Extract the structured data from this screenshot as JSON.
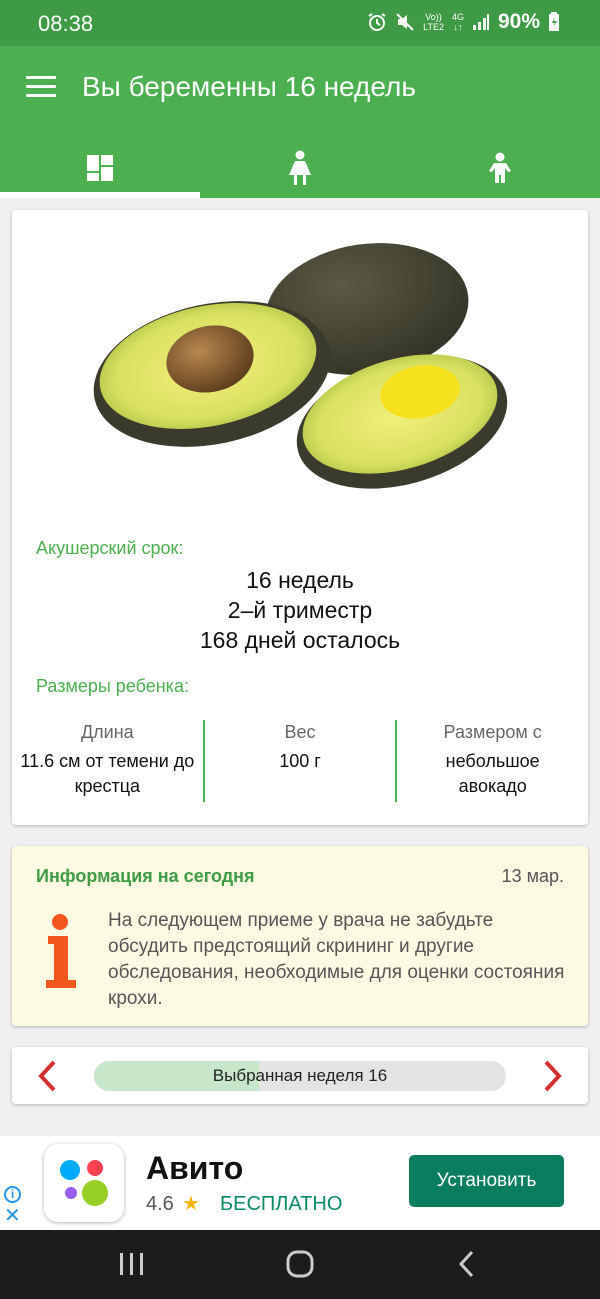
{
  "status_bar": {
    "time": "08:38",
    "volte_top": "Vo))",
    "volte_bottom": "LTE2",
    "network": "4G",
    "battery": "90%"
  },
  "app_bar": {
    "title": "Вы беременны 16 недель",
    "tabs": [
      {
        "icon": "dashboard-icon",
        "active": true
      },
      {
        "icon": "woman-icon",
        "active": false
      },
      {
        "icon": "child-icon",
        "active": false
      }
    ]
  },
  "week_card": {
    "image": "avocado",
    "obstetric_label": "Акушерский срок:",
    "weeks": "16 недель",
    "trimester": "2–й триместр",
    "days_left": "168 дней осталось",
    "baby_size_label": "Размеры ребенка:",
    "columns": [
      {
        "caption": "Длина",
        "value": "11.6 см от темени до крестца"
      },
      {
        "caption": "Вес",
        "value": "100 г"
      },
      {
        "caption": "Размером с",
        "value": "небольшое авокадо"
      }
    ]
  },
  "today_card": {
    "heading": "Информация на сегодня",
    "date": "13 мар.",
    "text": "На следующем приеме у врача не забудьте обсудить предстоящий скрининг и другие обследования, необходимые для оценки состояния крохи."
  },
  "week_selector": {
    "label": "Выбранная неделя 16",
    "progress_fraction": 0.4
  },
  "ad": {
    "app_name": "Авито",
    "rating": "4.6",
    "price": "БЕСПЛАТНО",
    "install_label": "Установить"
  },
  "colors": {
    "status_bar": "#3f9a45",
    "app_bar": "#4caf50",
    "accent_green": "#4caf50",
    "arrow_red": "#d32f2f",
    "info_orange": "#f2561d",
    "install_button": "#0a7d5e"
  }
}
